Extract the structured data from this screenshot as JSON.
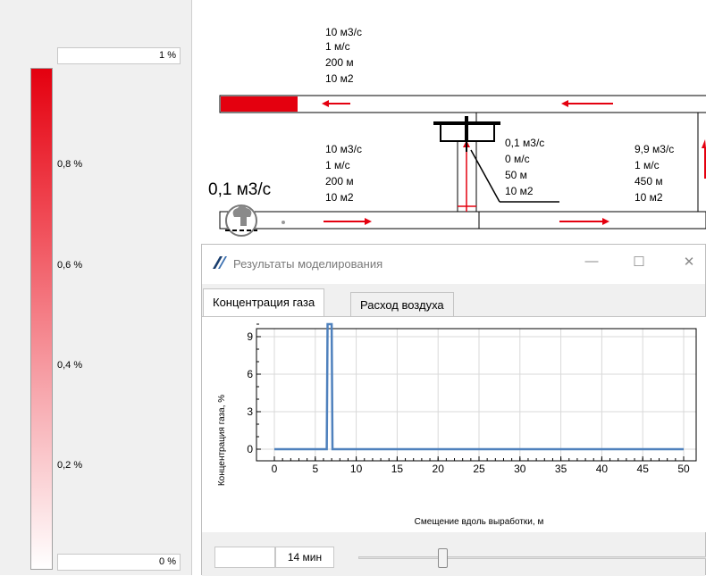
{
  "legend": {
    "top_value": "1 %",
    "bottom_value": "0 %",
    "ticks": [
      "0,8 %",
      "0,6 %",
      "0,4 %",
      "0,2 %"
    ]
  },
  "scheme": {
    "top_branch": [
      "10 м3/с",
      "1 м/с",
      "200 м",
      "10 м2"
    ],
    "lower_left_branch": [
      "10 м3/с",
      "1 м/с",
      "200 м",
      "10 м2"
    ],
    "middle_branch": [
      "0,1 м3/с",
      "0 м/с",
      "50 м",
      "10 м2"
    ],
    "right_branch": [
      "9,9 м3/с",
      "1 м/с",
      "450 м",
      "10 м2"
    ],
    "source_flow": "0,1 м3/с",
    "colors": {
      "gas": "#e4000f",
      "arrow": "#e4000f",
      "line": "#000000"
    }
  },
  "window": {
    "title": "Результаты моделирования",
    "tabs": [
      "Концентрация газа",
      "Расход воздуха"
    ],
    "active_tab": 0,
    "time_value": "14 мин",
    "slider_position": 0.24
  },
  "chart_data": {
    "type": "line",
    "xlabel": "Смещение вдоль выработки, м",
    "ylabel": "Концентрация газа, %",
    "xlim": [
      0,
      50
    ],
    "ylim": [
      0,
      10
    ],
    "xticks": [
      "0",
      "5",
      "10",
      "15",
      "20",
      "25",
      "30",
      "35",
      "40",
      "45",
      "50"
    ],
    "yticks": [
      "0",
      "3",
      "6",
      "9"
    ],
    "grid": true,
    "series": [
      {
        "color": "#4f81bd",
        "x": [
          0,
          6.4,
          6.5,
          7.0,
          7.1,
          50
        ],
        "y": [
          0,
          0,
          10,
          10,
          0,
          0
        ]
      }
    ]
  }
}
